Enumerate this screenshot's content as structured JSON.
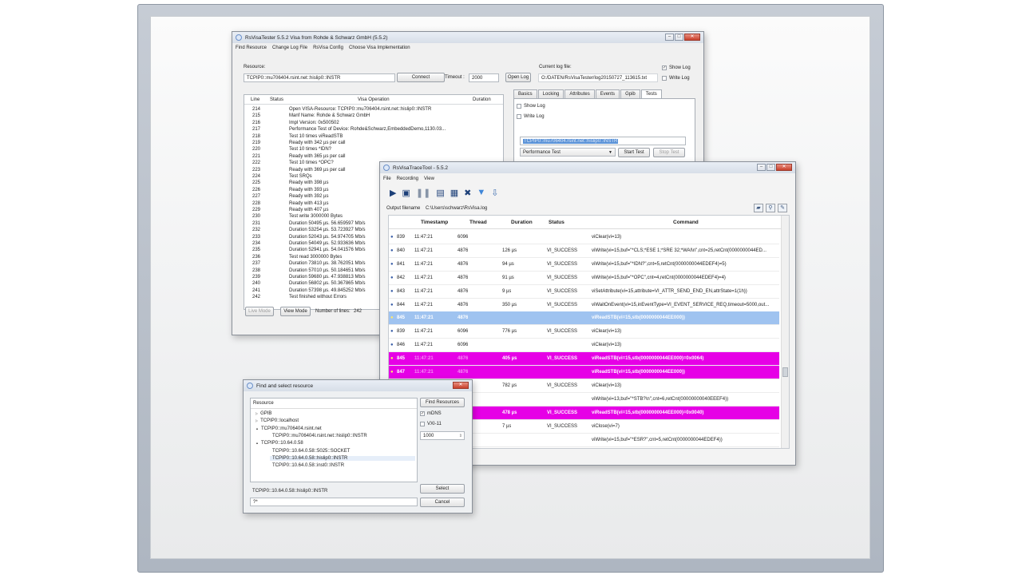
{
  "tester": {
    "title": "RsVisaTester 5.5.2 Visa from Rohde & Schwarz GmbH (5.5.2)",
    "menu": [
      "Find Resource",
      "Change Log File",
      "RsVisa Config",
      "Choose Visa Implementation"
    ],
    "resource_label": "Resource:",
    "resource_value": "TCPIP0::mu706404.rsint.net::hislip0::INSTR",
    "connect_label": "Connect",
    "timeout_label": "Timeout :",
    "timeout_value": "2000",
    "open_log_label": "Open Log",
    "current_log_label": "Current log file:",
    "current_log_value": "O:/DATEN/RsVisaTester/log20150727_113615.txt",
    "show_log_label": "Show Log",
    "write_log_label": "Write Log",
    "columns": [
      "Line",
      "Status",
      "Visa Operation",
      "Duration"
    ],
    "rows": [
      {
        "line": "214",
        "op": "Open VISA-Resource: TCPIP0::mu706404.rsint.net::hislip0::INSTR"
      },
      {
        "line": "215",
        "op": "Manf Name: Rohde & Schwarz GmbH"
      },
      {
        "line": "216",
        "op": "Impl Version: 0x500502"
      },
      {
        "line": "217",
        "op": "Performance Test of Device: Rohde&Schwarz,EmbeddedDemo,1130.03..."
      },
      {
        "line": "218",
        "op": "Test 10 times viReadSTB"
      },
      {
        "line": "219",
        "op": "Ready with 342 µs per call"
      },
      {
        "line": "220",
        "op": "Test 10 times *IDN?"
      },
      {
        "line": "221",
        "op": "Ready with 365 µs per call"
      },
      {
        "line": "222",
        "op": "Test 10 times *OPC?"
      },
      {
        "line": "223",
        "op": "Ready with 369 µs per call"
      },
      {
        "line": "224",
        "op": "Test SRQs"
      },
      {
        "line": "225",
        "op": "Ready with 398 µs"
      },
      {
        "line": "226",
        "op": "Ready with 393 µs"
      },
      {
        "line": "227",
        "op": "Ready with 392 µs"
      },
      {
        "line": "228",
        "op": "Ready with 413 µs"
      },
      {
        "line": "229",
        "op": "Ready with 407 µs"
      },
      {
        "line": "230",
        "op": "Test write 3000000 Bytes"
      },
      {
        "line": "231",
        "op": "Duration 50495 µs. 56.659597 Mb/s"
      },
      {
        "line": "232",
        "op": "Duration 53254 µs. 53.723927 Mb/s"
      },
      {
        "line": "233",
        "op": "Duration 52043 µs. 54.974705 Mb/s"
      },
      {
        "line": "234",
        "op": "Duration 54049 µs. 52.933636 Mb/s"
      },
      {
        "line": "235",
        "op": "Duration 52941 µs. 54.041576 Mb/s"
      },
      {
        "line": "236",
        "op": "Test read 3000000 Bytes"
      },
      {
        "line": "237",
        "op": "Duration 73810 µs. 38.762051 Mb/s"
      },
      {
        "line": "238",
        "op": "Duration 57010 µs. 50.184651 Mb/s"
      },
      {
        "line": "239",
        "op": "Duration 59680 µs. 47.938813 Mb/s"
      },
      {
        "line": "240",
        "op": "Duration 56802 µs. 50.367865 Mb/s"
      },
      {
        "line": "241",
        "op": "Duration 57398 µs. 49.845252 Mb/s"
      },
      {
        "line": "242",
        "op": "Test finished without Errors"
      }
    ],
    "tabs": [
      "Basics",
      "Locking",
      "Attributes",
      "Events",
      "Gpib",
      "Tests"
    ],
    "tests_show_log": "Show Log",
    "tests_write_log": "Write Log",
    "tests_resource": "TCPIP0::mu706404.rsint.net::hislip0::INSTR",
    "tests_select": "Performance Test",
    "start_test": "Start Test",
    "stop_test": "Stop Test",
    "live_mode": "Live Mode",
    "view_mode": "View Mode",
    "lines_label": "Number of lines:",
    "lines_value": "242"
  },
  "trace": {
    "title": "RsVisaTraceTool - 5.5.2",
    "menu": [
      "File",
      "Recording",
      "View"
    ],
    "output_label": "Output filename",
    "output_value": "C:\\Users\\schwarz\\RsVisa.log",
    "columns": [
      "Timestamp",
      "Thread",
      "Duration",
      "Status",
      "Command"
    ],
    "rows": [
      {
        "id": "839",
        "time": "11:47:21",
        "thread": "6096",
        "dur": "",
        "status": "",
        "cmd": "viClear(vi=13)",
        "style": ""
      },
      {
        "id": "840",
        "time": "11:47:21",
        "thread": "4876",
        "dur": "126 µs",
        "status": "VI_SUCCESS",
        "cmd": "viWrite(vi=15,buf=\"*CLS;*ESE 1;*SRE 32;*WAI\\n\",cnt=25,retCnt(0000000044ED...",
        "style": ""
      },
      {
        "id": "841",
        "time": "11:47:21",
        "thread": "4876",
        "dur": "94 µs",
        "status": "VI_SUCCESS",
        "cmd": "viWrite(vi=15,buf=\"*IDN?\",cnt=5,retCnt(0000000044EDEF4)=5)",
        "style": ""
      },
      {
        "id": "842",
        "time": "11:47:21",
        "thread": "4876",
        "dur": "91 µs",
        "status": "VI_SUCCESS",
        "cmd": "viWrite(vi=15,buf=\"*OPC\",cnt=4,retCnt(0000000044EDEF4)=4)",
        "style": ""
      },
      {
        "id": "843",
        "time": "11:47:21",
        "thread": "4876",
        "dur": "9 µs",
        "status": "VI_SUCCESS",
        "cmd": "viSetAttribute(vi=15,attribute=VI_ATTR_SEND_END_EN,attrState=1(1h))",
        "style": ""
      },
      {
        "id": "844",
        "time": "11:47:21",
        "thread": "4876",
        "dur": "350 µs",
        "status": "VI_SUCCESS",
        "cmd": "viWaitOnEvent(vi=15,inEventType=VI_EVENT_SERVICE_REQ,timeout=5000,out...",
        "style": ""
      },
      {
        "id": "845",
        "time": "11:47:21",
        "thread": "4876",
        "dur": "",
        "status": "",
        "cmd": "viReadSTB(vi=15,stb(0000000044EE000))",
        "style": "sel"
      },
      {
        "id": "839",
        "time": "11:47:21",
        "thread": "6096",
        "dur": "776 µs",
        "status": "VI_SUCCESS",
        "cmd": "viClear(vi=13)",
        "style": ""
      },
      {
        "id": "846",
        "time": "11:47:21",
        "thread": "6096",
        "dur": "",
        "status": "",
        "cmd": "viClear(vi=13)",
        "style": ""
      },
      {
        "id": "845",
        "time": "11:47:21",
        "thread": "4876",
        "dur": "405 µs",
        "status": "VI_SUCCESS",
        "cmd": "viReadSTB(vi=15,stb(0000000044EE000)=0x0064)",
        "style": "mag"
      },
      {
        "id": "847",
        "time": "11:47:21",
        "thread": "4876",
        "dur": "",
        "status": "",
        "cmd": "viReadSTB(vi=15,stb(0000000044EE000))",
        "style": "mag"
      },
      {
        "id": "",
        "time": "",
        "thread": "",
        "dur": "782 µs",
        "status": "VI_SUCCESS",
        "cmd": "viClear(vi=13)",
        "style": ""
      },
      {
        "id": "",
        "time": "",
        "thread": "",
        "dur": "",
        "status": "",
        "cmd": "viWrite(vi=13,buf=\"*STB?\\n\",cnt=6,retCnt(00000000040EEEF4))",
        "style": ""
      },
      {
        "id": "",
        "time": "",
        "thread": "",
        "dur": "478 µs",
        "status": "VI_SUCCESS",
        "cmd": "viReadSTB(vi=15,stb(0000000044EE000)=0x0040)",
        "style": "mag"
      },
      {
        "id": "",
        "time": "",
        "thread": "",
        "dur": "7 µs",
        "status": "VI_SUCCESS",
        "cmd": "viClose(vi=7)",
        "style": ""
      },
      {
        "id": "",
        "time": "",
        "thread": "",
        "dur": "",
        "status": "",
        "cmd": "viWrite(vi=15,buf=\"*ESR?\",cnt=5,retCnt(0000000044EDEF4))",
        "style": ""
      }
    ]
  },
  "finder": {
    "title": "Find and select resource",
    "resource_header": "Resource",
    "tree": [
      {
        "text": "GPIB",
        "indent": 0,
        "marker": ""
      },
      {
        "text": "TCPIP0::localhost",
        "indent": 0,
        "marker": ""
      },
      {
        "text": "TCPIP0::mu706404.rsint.net",
        "indent": 0,
        "marker": "▲"
      },
      {
        "text": "TCPIP0::mu706404l.rsint.net::hislip0::INSTR",
        "indent": 1,
        "marker": ""
      },
      {
        "text": "TCPIP0::10.64.0.58",
        "indent": 0,
        "marker": "▲"
      },
      {
        "text": "TCPIP0::10.64.0.58::5025::SOCKET",
        "indent": 1,
        "marker": ""
      },
      {
        "text": "TCPIP0::10.64.0.58::hislip0::INSTR",
        "indent": 1,
        "marker": ""
      },
      {
        "text": "TCPIP0::10.64.0.58::inst0::INSTR",
        "indent": 1,
        "marker": ""
      }
    ],
    "find_resources": "Find Resources",
    "mdns_label": "mDNS",
    "vxi_label": "VXI-11",
    "timeout_value": "1000",
    "selected_value": "TCPIP0::10.64.0.58::hislip0::INSTR",
    "filter_value": "?*",
    "select_label": "Select",
    "cancel_label": "Cancel"
  }
}
